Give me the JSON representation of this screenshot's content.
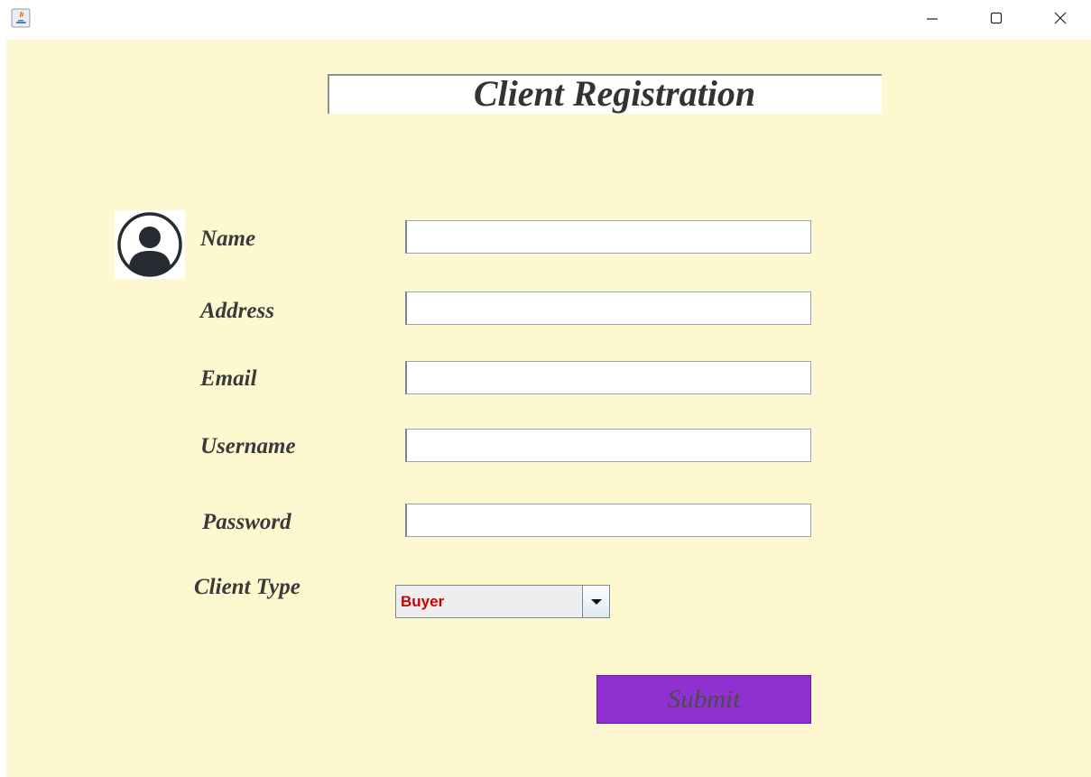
{
  "window": {
    "controls": {
      "minimize_icon": "minimize-icon",
      "maximize_icon": "maximize-icon",
      "close_icon": "close-icon"
    }
  },
  "form": {
    "title": "Client Registration",
    "avatar_icon": "user-avatar-icon",
    "fields": {
      "name": {
        "label": "Name",
        "value": ""
      },
      "address": {
        "label": "Address",
        "value": ""
      },
      "email": {
        "label": "Email",
        "value": ""
      },
      "username": {
        "label": "Username",
        "value": ""
      },
      "password": {
        "label": "Password",
        "value": ""
      }
    },
    "client_type": {
      "label": "Client Type",
      "selected": "Buyer"
    },
    "submit_label": "Submit"
  },
  "colors": {
    "background": "#fdf8cf",
    "submit_button": "#9130d0",
    "combo_text": "#d00000"
  }
}
